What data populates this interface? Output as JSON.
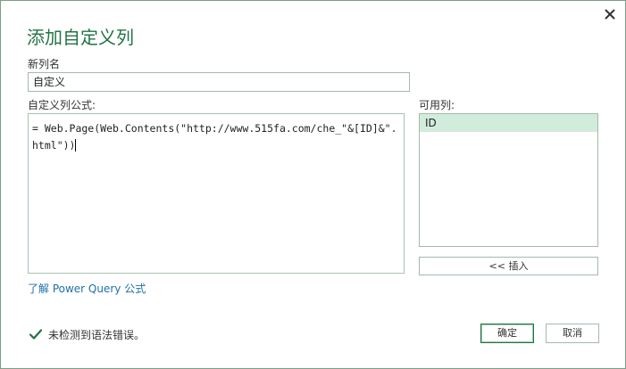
{
  "dialog": {
    "title": "添加自定义列",
    "close_icon": "close-icon"
  },
  "new_column": {
    "label": "新列名",
    "value": "自定义"
  },
  "formula": {
    "label": "自定义列公式:",
    "value": "= Web.Page(Web.Contents(\"http://www.515fa.com/che_\"&[ID]&\".html\"))"
  },
  "available_columns": {
    "label": "可用列:",
    "items": [
      "ID"
    ],
    "insert_label": "<< 插入"
  },
  "learn_link": "了解 Power Query 公式",
  "status": {
    "icon": "check-icon",
    "text": "未检测到语法错误。",
    "color": "#217346"
  },
  "buttons": {
    "ok": "确定",
    "cancel": "取消"
  },
  "colors": {
    "accent": "#217346",
    "selection": "#d2ecdc",
    "link": "#1f6fa8"
  }
}
